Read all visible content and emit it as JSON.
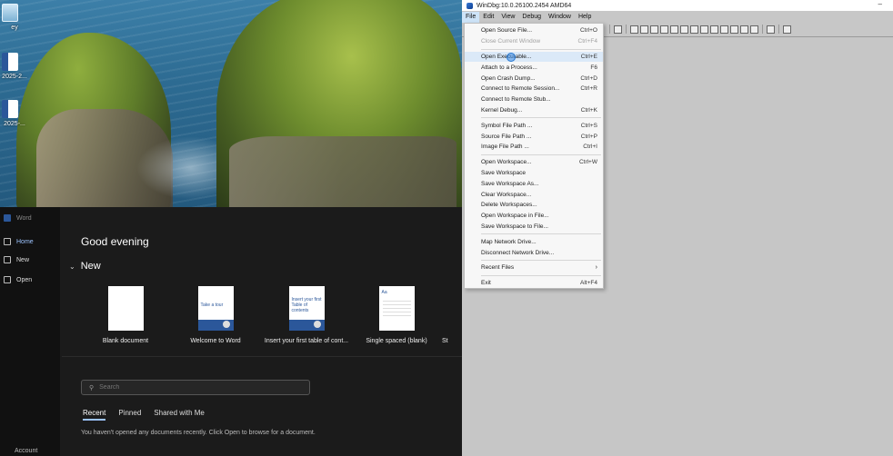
{
  "desktop": {
    "icons": [
      {
        "name": "recycle",
        "label": "ey"
      },
      {
        "name": "word-doc-1",
        "label": "2025-2..."
      },
      {
        "name": "word-doc-2",
        "label": "2025-..."
      }
    ]
  },
  "word": {
    "app_title": "Word",
    "nav": [
      {
        "label": "Home",
        "icon": "home-icon"
      },
      {
        "label": "New",
        "icon": "new-doc-icon"
      },
      {
        "label": "Open",
        "icon": "folder-icon"
      }
    ],
    "account_label": "Account",
    "greeting": "Good evening",
    "new_section": "New",
    "templates": [
      {
        "label": "Blank document"
      },
      {
        "label": "Welcome to Word",
        "thumb_text": "Take a tour"
      },
      {
        "label": "Insert your first table of cont...",
        "thumb_text": "Insert your first Table of contents"
      },
      {
        "label": "Single spaced (blank)",
        "thumb_text": "Aa"
      },
      {
        "label": "St"
      }
    ],
    "search_placeholder": "Search",
    "tabs": [
      "Recent",
      "Pinned",
      "Shared with Me"
    ],
    "empty_message": "You haven't opened any documents recently. Click Open to browse for a document."
  },
  "windbg": {
    "title": "WinDbg:10.0.26100.2454 AMD64",
    "minimize": "–",
    "menus": [
      "File",
      "Edit",
      "View",
      "Debug",
      "Window",
      "Help"
    ],
    "file_menu": [
      {
        "label": "Open Source File...",
        "shortcut": "Ctrl+O"
      },
      {
        "label": "Close Current Window",
        "shortcut": "Ctrl+F4",
        "disabled": true
      },
      {
        "sep": true
      },
      {
        "label": "Open Executable...",
        "shortcut": "Ctrl+E",
        "hover": true
      },
      {
        "label": "Attach to a Process...",
        "shortcut": "F6"
      },
      {
        "label": "Open Crash Dump...",
        "shortcut": "Ctrl+D"
      },
      {
        "label": "Connect to Remote Session...",
        "shortcut": "Ctrl+R"
      },
      {
        "label": "Connect to Remote Stub...",
        "shortcut": ""
      },
      {
        "label": "Kernel Debug...",
        "shortcut": "Ctrl+K"
      },
      {
        "sep": true
      },
      {
        "label": "Symbol File Path ...",
        "shortcut": "Ctrl+S"
      },
      {
        "label": "Source File Path ...",
        "shortcut": "Ctrl+P"
      },
      {
        "label": "Image File Path ...",
        "shortcut": "Ctrl+I"
      },
      {
        "sep": true
      },
      {
        "label": "Open Workspace...",
        "shortcut": "Ctrl+W"
      },
      {
        "label": "Save Workspace",
        "shortcut": ""
      },
      {
        "label": "Save Workspace As...",
        "shortcut": ""
      },
      {
        "label": "Clear Workspace...",
        "shortcut": ""
      },
      {
        "label": "Delete Workspaces...",
        "shortcut": ""
      },
      {
        "label": "Open Workspace in File...",
        "shortcut": ""
      },
      {
        "label": "Save Workspace to File...",
        "shortcut": ""
      },
      {
        "sep": true
      },
      {
        "label": "Map Network Drive...",
        "shortcut": ""
      },
      {
        "label": "Disconnect Network Drive...",
        "shortcut": ""
      },
      {
        "sep": true
      },
      {
        "label": "Recent Files",
        "shortcut": "",
        "submenu": true
      },
      {
        "sep": true
      },
      {
        "label": "Exit",
        "shortcut": "Alt+F4"
      }
    ]
  }
}
